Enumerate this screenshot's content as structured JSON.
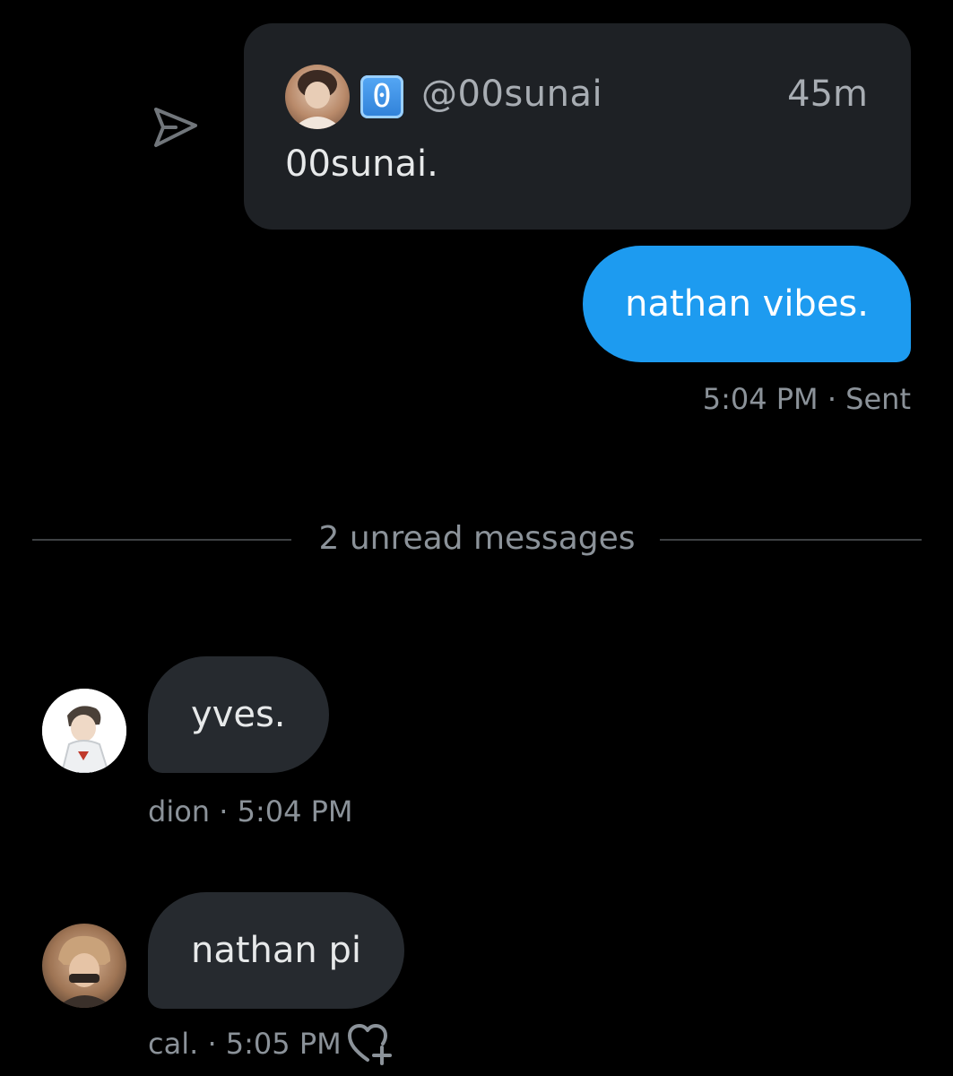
{
  "shared_post": {
    "emoji": "0",
    "handle": "@00sunai",
    "time": "45m",
    "text": "00sunai."
  },
  "messages": [
    {
      "direction": "outgoing",
      "text": "nathan vibes.",
      "meta": "5:04 PM · Sent"
    },
    {
      "direction": "incoming",
      "sender": "dion",
      "text": "yves.",
      "meta": "dion · 5:04 PM"
    },
    {
      "direction": "incoming",
      "sender": "cal.",
      "text": "nathan pi",
      "meta": "cal. · 5:05 PM"
    }
  ],
  "divider": {
    "label": "2 unread messages"
  },
  "icons": {
    "share": "share-icon",
    "add_reaction": "add-reaction-icon"
  },
  "colors": {
    "background": "#000000",
    "outgoing_bubble": "#1d9bf0",
    "incoming_bubble": "#262a2f",
    "card": "#1e2125",
    "muted_text": "#8b9299"
  }
}
